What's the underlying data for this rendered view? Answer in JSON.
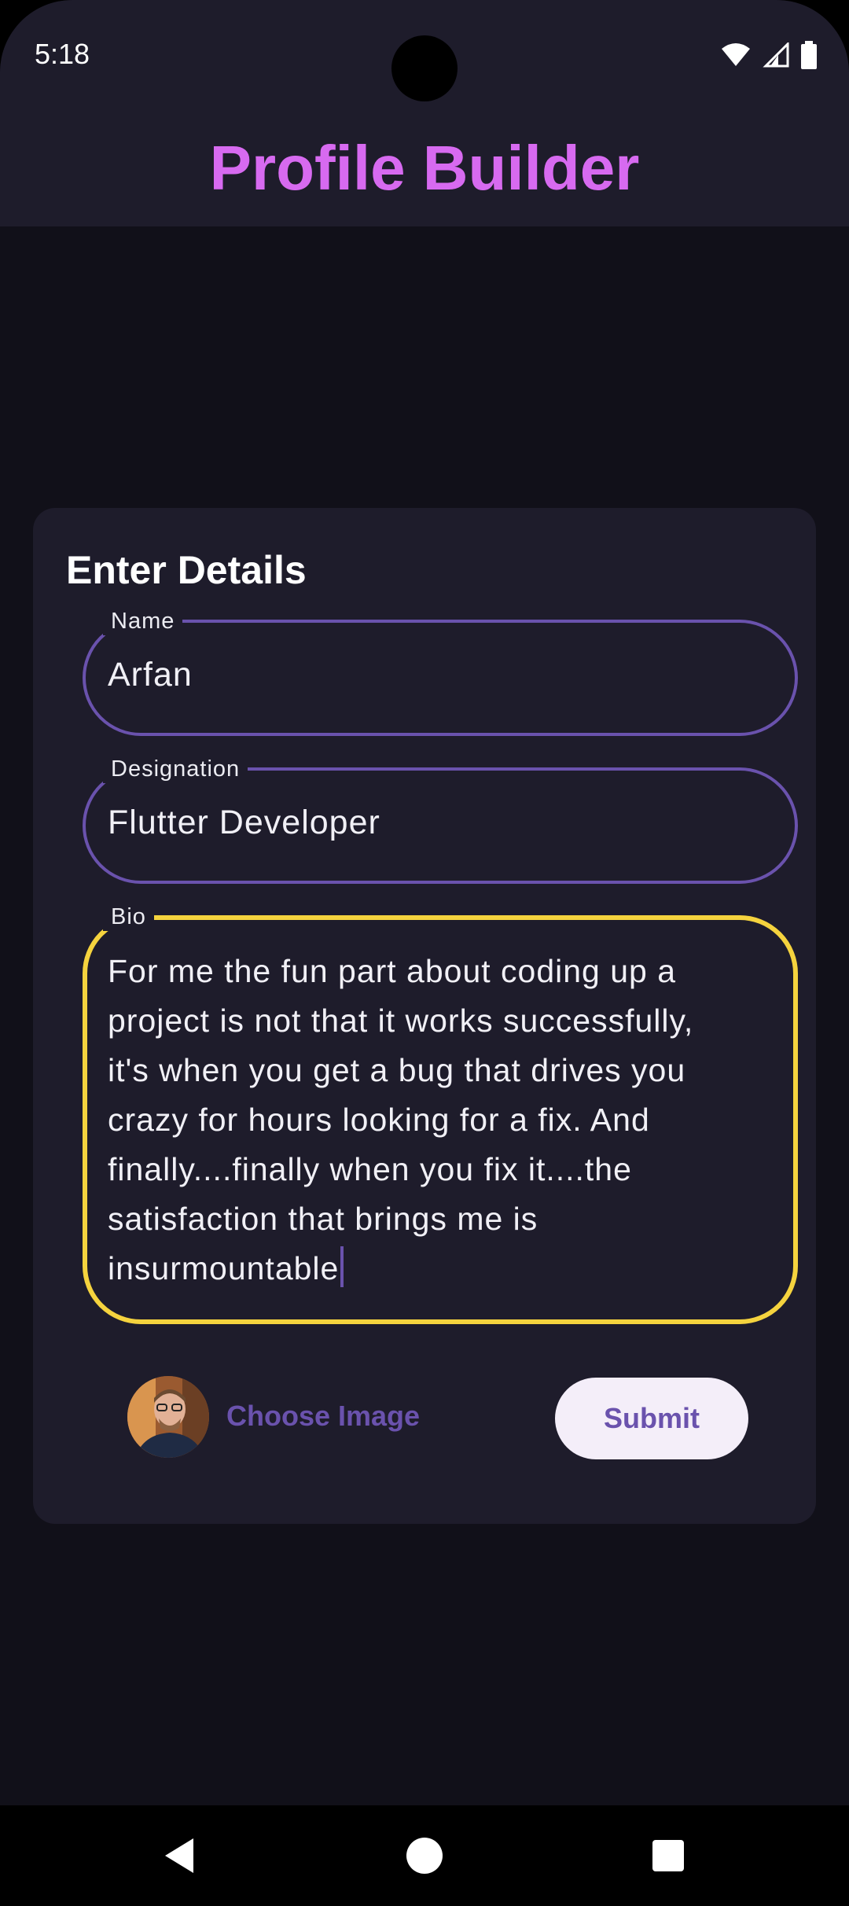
{
  "status_bar": {
    "time": "5:18",
    "icons": [
      "wifi-icon",
      "signal-icon",
      "battery-icon"
    ]
  },
  "app_bar": {
    "title": "Profile Builder"
  },
  "form": {
    "heading": "Enter Details",
    "name": {
      "label": "Name",
      "value": "Arfan"
    },
    "designation": {
      "label": "Designation",
      "value": "Flutter Developer"
    },
    "bio": {
      "label": "Bio",
      "lines": [
        "For me the fun part about coding up a",
        "project is not that it works successfully,",
        "it's when you get a bug that drives you",
        "crazy for hours looking for a fix. And",
        "finally....finally when you fix it....the",
        "satisfaction that brings me is",
        "insurmountable"
      ]
    },
    "choose_image_label": "Choose Image",
    "submit_label": "Submit"
  },
  "nav_bar": {
    "icons": [
      "back-icon",
      "home-icon",
      "recents-icon"
    ]
  },
  "colors": {
    "background": "#111019",
    "surface": "#1e1c2b",
    "title_accent": "#d76af0",
    "primary": "#6a52ad",
    "focus_border": "#f5d33e",
    "submit_bg": "#f4eef9"
  }
}
